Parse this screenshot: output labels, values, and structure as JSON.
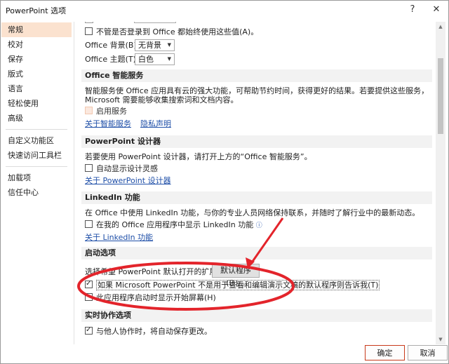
{
  "window": {
    "title": "PowerPoint 选项",
    "help_glyph": "?",
    "close_glyph": "✕"
  },
  "sidebar": {
    "items": [
      {
        "label": "常规"
      },
      {
        "label": "校对"
      },
      {
        "label": "保存"
      },
      {
        "label": "版式"
      },
      {
        "label": "语言"
      },
      {
        "label": "轻松使用"
      },
      {
        "label": "高级"
      },
      {
        "label": "自定义功能区"
      },
      {
        "label": "快速访问工具栏"
      },
      {
        "label": "加载项"
      },
      {
        "label": "信任中心"
      }
    ],
    "active": "常规"
  },
  "content": {
    "always_use_values": "不管是否登录到 Office 都始终使用这些值(A)。",
    "office_background_label": "Office 背景(B):",
    "office_background_value": "无背景",
    "office_theme_label": "Office 主题(T):",
    "office_theme_value": "白色",
    "intelligent_services": {
      "header": "Office 智能服务",
      "description": "智能服务使 Office 应用具有云的强大功能，可帮助节约时间，获得更好的结果。若要提供这些服务，Microsoft 需要能够收集搜索词和文档内容。",
      "enable_label": "启用服务",
      "about_link": "关于智能服务",
      "privacy_link": "隐私声明"
    },
    "designer": {
      "header": "PowerPoint 设计器",
      "description": "若要使用 PowerPoint 设计器，请打开上方的“Office 智能服务”。",
      "auto_show_label": "自动显示设计灵感",
      "about_link": "关于 PowerPoint 设计器"
    },
    "linkedin": {
      "header": "LinkedIn 功能",
      "description": "在 Office 中使用 LinkedIn 功能，与你的专业人员网络保持联系，并随时了解行业中的最新动态。",
      "show_label": "在我的 Office 应用程序中显示 LinkedIn 功能",
      "about_link": "关于 LinkedIn 功能"
    },
    "startup": {
      "header": "启动选项",
      "extensions_label": "选择希望 PowerPoint 默认打开的扩展名:",
      "default_programs_button": "默认程序(D)...",
      "not_default_label": "如果 Microsoft PowerPoint 不是用于查看和编辑演示文稿的默认程序则告诉我(T)",
      "show_start_screen_label": "此应用程序启动时显示开始屏幕(H)"
    },
    "coauthoring": {
      "header": "实时协作选项",
      "autosave_label": "与他人协作时，将自动保存更改。"
    }
  },
  "footer": {
    "ok_label": "确定",
    "cancel_label": "取消"
  },
  "colors": {
    "annotation_red": "#e3242b",
    "active_nav": "#fbe2cf",
    "section_bg": "#f2f2f2",
    "link": "#1f4fa8"
  }
}
